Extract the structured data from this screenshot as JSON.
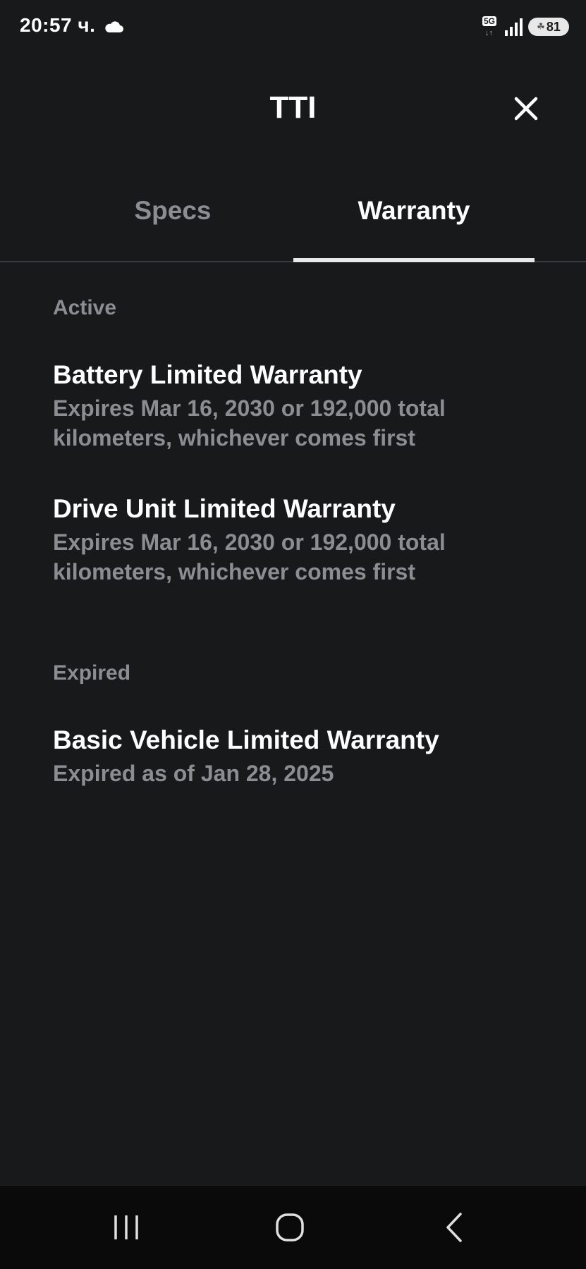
{
  "status_bar": {
    "time": "20:57 ч.",
    "network": "5G",
    "network_arrows": "↓↑",
    "battery_level": "81",
    "icons": [
      "cloud-icon",
      "signal-icon",
      "battery-saver-icon"
    ]
  },
  "header": {
    "title": "TTI",
    "close_icon": "close-icon"
  },
  "tabs": [
    {
      "label": "Specs",
      "active": false
    },
    {
      "label": "Warranty",
      "active": true
    }
  ],
  "sections": {
    "active": {
      "label": "Active",
      "items": [
        {
          "title": "Battery Limited Warranty",
          "description": "Expires Mar 16, 2030 or 192,000 total kilometers, whichever comes first"
        },
        {
          "title": "Drive Unit Limited Warranty",
          "description": "Expires Mar 16, 2030 or 192,000 total kilometers, whichever comes first"
        }
      ]
    },
    "expired": {
      "label": "Expired",
      "items": [
        {
          "title": "Basic Vehicle Limited Warranty",
          "description": "Expired as of Jan 28, 2025"
        }
      ]
    }
  },
  "nav_bar": {
    "buttons": [
      "recents-icon",
      "home-icon",
      "back-icon"
    ]
  },
  "colors": {
    "background": "#18191b",
    "text_primary": "#ffffff",
    "text_secondary": "#8c8d90",
    "divider": "#3a3b3e",
    "nav_background": "#0a0a0b"
  }
}
